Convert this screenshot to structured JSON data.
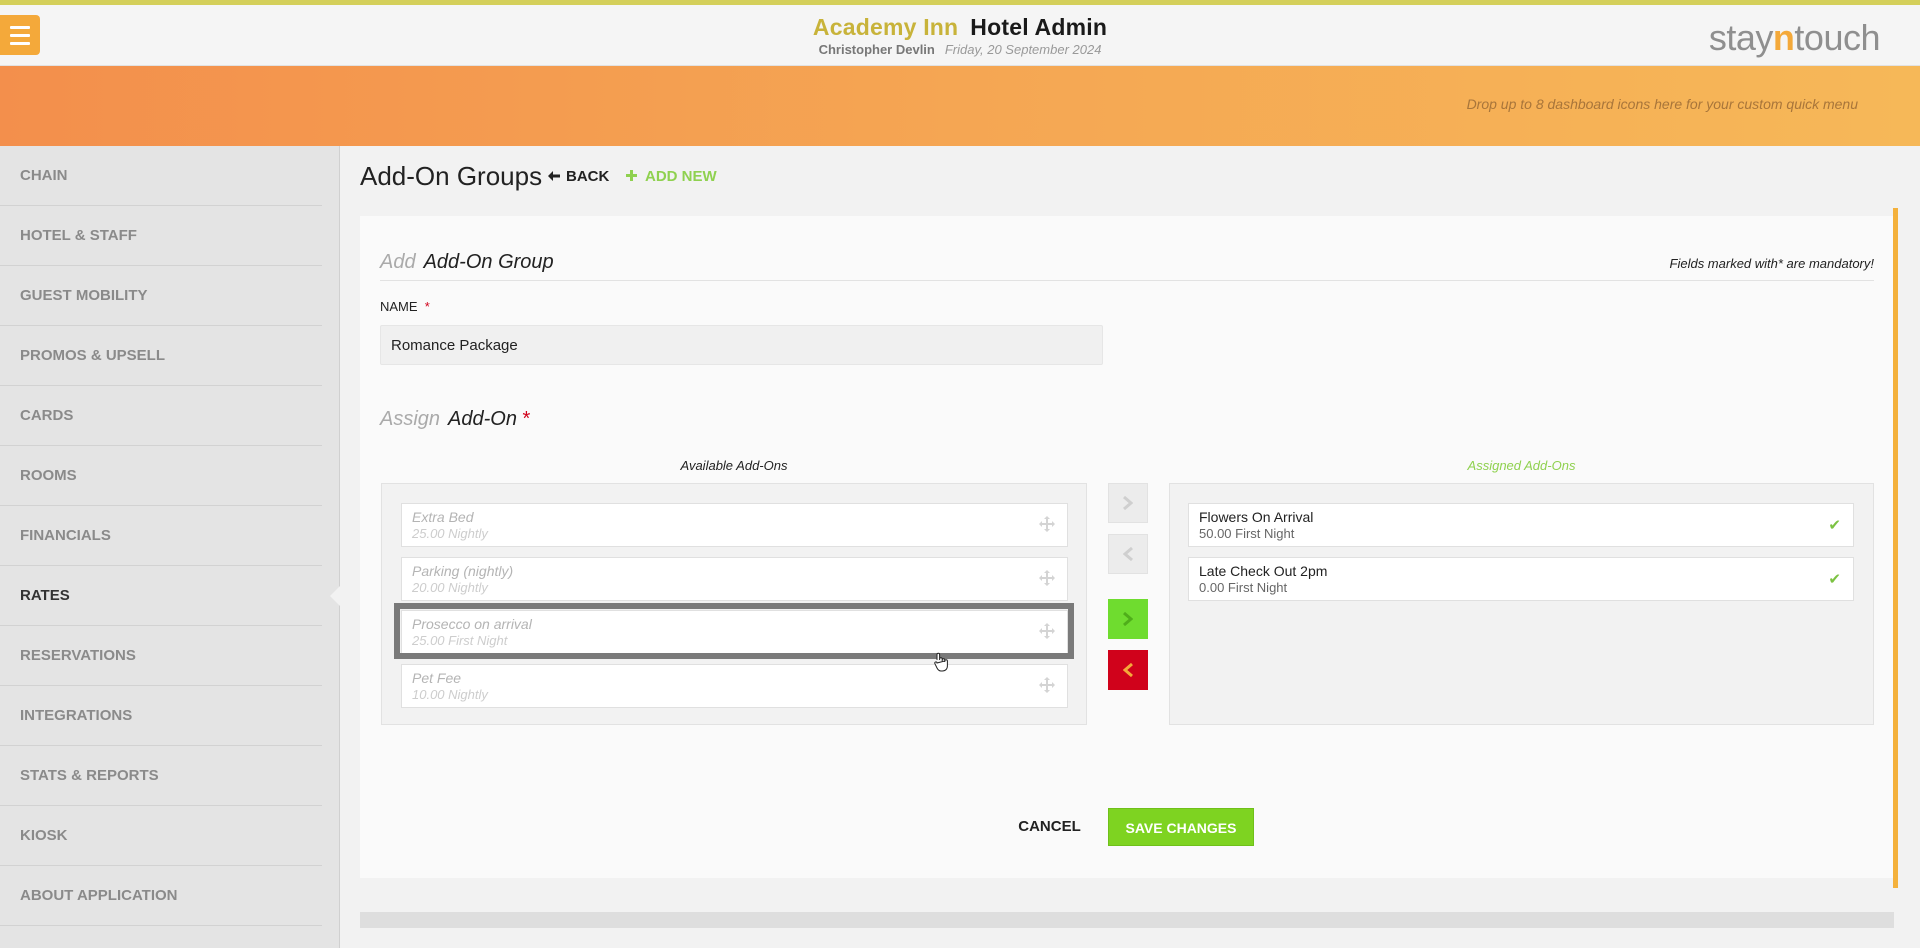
{
  "header": {
    "hotel_name": "Academy Inn",
    "app_name": "Hotel Admin",
    "user_name": "Christopher Devlin",
    "date": "Friday, 20 September 2024",
    "logo_prefix": "stay",
    "logo_highlight": "n",
    "logo_suffix": "touch",
    "accent_color": "#f4a93a"
  },
  "banner": {
    "text": "Drop up to 8 dashboard icons here for your custom quick menu"
  },
  "sidebar": {
    "items": [
      {
        "label": "CHAIN"
      },
      {
        "label": "HOTEL & STAFF"
      },
      {
        "label": "GUEST MOBILITY"
      },
      {
        "label": "PROMOS & UPSELL"
      },
      {
        "label": "CARDS"
      },
      {
        "label": "ROOMS"
      },
      {
        "label": "FINANCIALS"
      },
      {
        "label": "RATES",
        "active": true
      },
      {
        "label": "RESERVATIONS"
      },
      {
        "label": "INTEGRATIONS"
      },
      {
        "label": "STATS & REPORTS"
      },
      {
        "label": "KIOSK"
      },
      {
        "label": "ABOUT APPLICATION"
      }
    ]
  },
  "page": {
    "title": "Add-On Groups",
    "back_label": "BACK",
    "add_new_label": "ADD NEW"
  },
  "form": {
    "section_muted": "Add",
    "section_title": "Add-On Group",
    "mandatory_note": "Fields marked with* are mandatory!",
    "name_label": "NAME",
    "required_mark": "*",
    "name_value": "Romance Package",
    "assign_muted": "Assign",
    "assign_title": "Add-On",
    "available_label": "Available Add-Ons",
    "assigned_label": "Assigned Add-Ons",
    "available": [
      {
        "name": "Extra Bed",
        "price": "25.00 Nightly"
      },
      {
        "name": "Parking (nightly)",
        "price": "20.00 Nightly"
      },
      {
        "name": "Prosecco on arrival",
        "price": "25.00 First Night",
        "highlighted": true
      },
      {
        "name": "Pet Fee",
        "price": "10.00 Nightly"
      }
    ],
    "assigned": [
      {
        "name": "Flowers On Arrival",
        "price": "50.00 First Night"
      },
      {
        "name": "Late Check Out 2pm",
        "price": "0.00 First Night"
      }
    ],
    "cancel_label": "CANCEL",
    "save_label": "SAVE CHANGES"
  },
  "icons": {
    "menu": "hamburger-icon",
    "back": "arrow-left-icon",
    "add": "plus-icon",
    "drag": "move-icon",
    "check": "check-icon",
    "right": "chevron-right-icon",
    "left": "chevron-left-icon"
  },
  "colors": {
    "brand_orange": "#f4a93a",
    "green": "#7ed321",
    "red": "#d0021b",
    "hotel_name": "#c8b33a"
  }
}
